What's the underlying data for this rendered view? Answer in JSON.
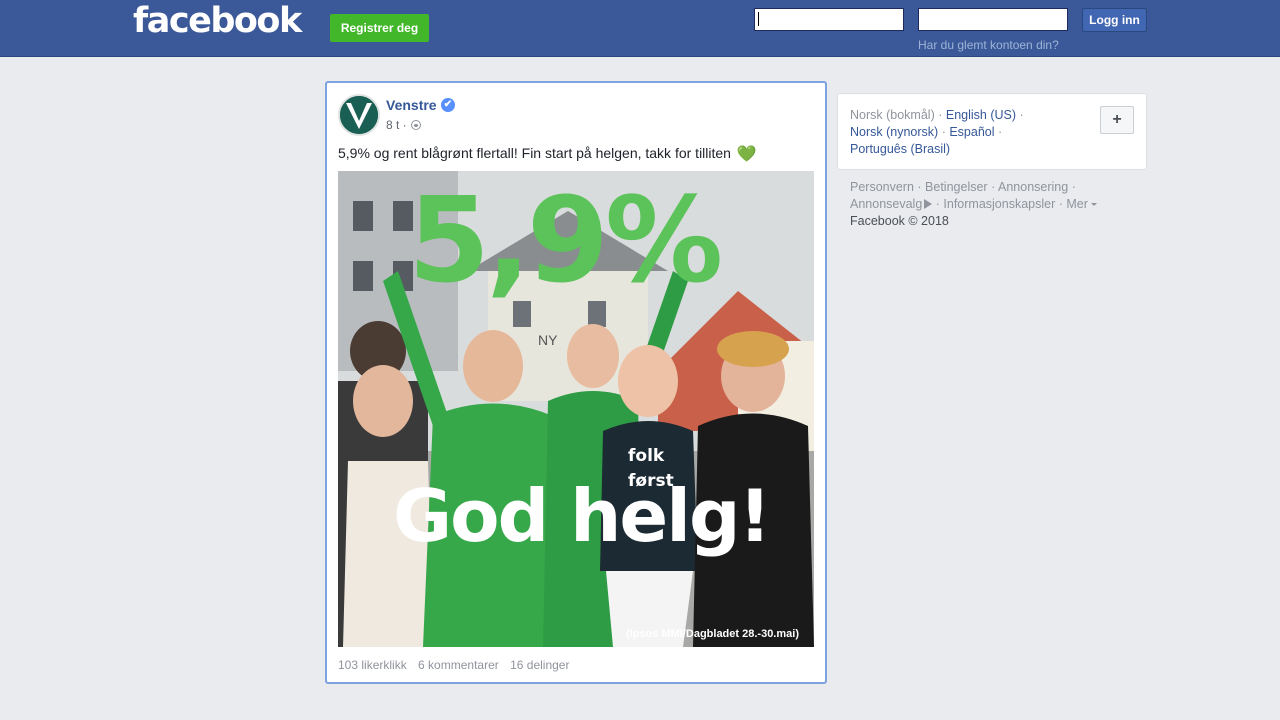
{
  "header": {
    "logo": "facebook",
    "register_label": "Registrer deg",
    "email_value": "",
    "password_value": "",
    "login_label": "Logg inn",
    "forgot_label": "Har du glemt kontoen din?"
  },
  "post": {
    "author": "Venstre",
    "verified_mark": "✔",
    "time": "8 t ·",
    "text": "5,9% og rent blågrønt flertall! Fin start på helgen, takk for tilliten",
    "heart": "💚",
    "image": {
      "big_number": "5,9%",
      "greeting": "God helg!",
      "shirt_text_1": "folk",
      "shirt_text_2": "først",
      "sign_text": "NY",
      "source": "(Ipsos MMI/Dagbladet 28.-30.mai)"
    },
    "stats": {
      "likes": "103 likerklikk",
      "comments": "6 kommentarer",
      "shares": "16 delinger"
    }
  },
  "languages": {
    "current": "Norsk (bokmål)",
    "items": [
      "English (US)",
      "Norsk (nynorsk)",
      "Español",
      "Português (Brasil)"
    ],
    "add_label": "+"
  },
  "footer": {
    "links": [
      "Personvern",
      "Betingelser",
      "Annonsering",
      "Annonsevalg",
      "Informasjonskapsler",
      "Mer"
    ],
    "copyright": "Facebook © 2018"
  },
  "colors": {
    "brand_blue": "#3b5998",
    "register_green": "#42b72a",
    "party_green": "#5cc25a",
    "link_blue": "#365899"
  }
}
